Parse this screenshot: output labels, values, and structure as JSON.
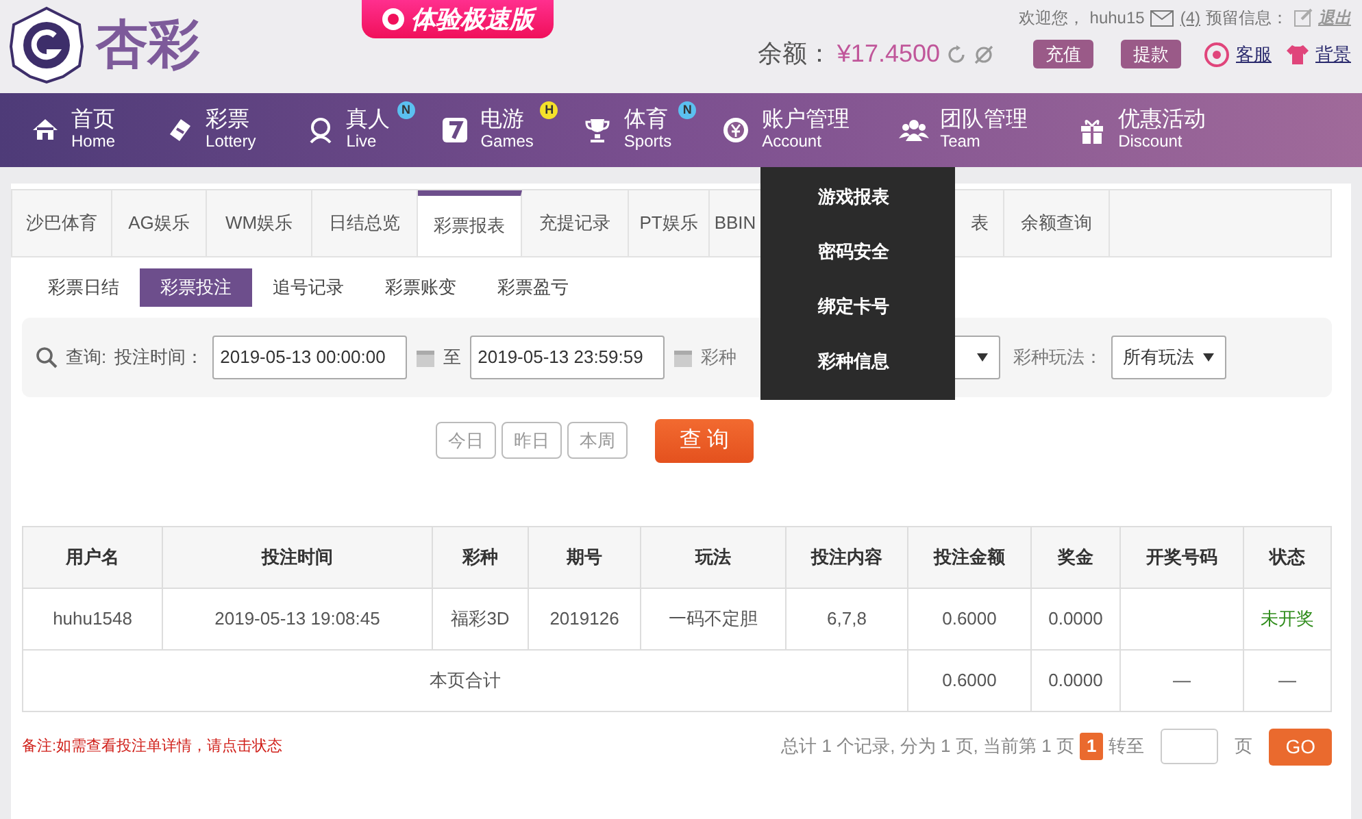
{
  "header": {
    "logo_text": "杏彩",
    "promo_button": "体验极速版",
    "user_bar": {
      "welcome": "欢迎您，",
      "username": "huhu15",
      "mail_count": "(4)",
      "reserve_label": "预留信息：",
      "logout": "退出"
    },
    "balance": {
      "label": "余额：",
      "amount": "¥17.4500",
      "buttons": [
        "充值",
        "提款"
      ],
      "service": "客服",
      "background": "背景"
    }
  },
  "nav": [
    {
      "label": "首页",
      "sub": "Home"
    },
    {
      "label": "彩票",
      "sub": "Lottery"
    },
    {
      "label": "真人",
      "sub": "Live",
      "badge": "N",
      "color": "#5bc0f0"
    },
    {
      "label": "电游",
      "sub": "Games",
      "badge": "H",
      "color": "#f5e12a"
    },
    {
      "label": "体育",
      "sub": "Sports",
      "badge": "N",
      "color": "#5bc0f0"
    },
    {
      "label": "账户管理",
      "sub": "Account"
    },
    {
      "label": "团队管理",
      "sub": "Team"
    },
    {
      "label": "优惠活动",
      "sub": "Discount"
    }
  ],
  "dropdown": [
    "游戏报表",
    "密码安全",
    "绑定卡号",
    "彩种信息"
  ],
  "tabs": [
    {
      "label": "沙巴体育",
      "selected": false
    },
    {
      "label": "AG娱乐",
      "selected": false
    },
    {
      "label": "WM娱乐",
      "selected": false
    },
    {
      "label": "日结总览",
      "selected": false
    },
    {
      "label": "彩票报表",
      "selected": true
    },
    {
      "label": "充提记录",
      "selected": false
    },
    {
      "label": "PT娱乐",
      "selected": false
    },
    {
      "label": "BBIN",
      "selected": false
    },
    {
      "label": "表",
      "selected": false
    },
    {
      "label": "余额查询",
      "selected": false
    }
  ],
  "subtabs": [
    {
      "label": "彩票日结",
      "selected": false
    },
    {
      "label": "彩票投注",
      "selected": true
    },
    {
      "label": "追号记录",
      "selected": false
    },
    {
      "label": "彩票账变",
      "selected": false
    },
    {
      "label": "彩票盈亏",
      "selected": false
    }
  ],
  "filter": {
    "query_label": "查询:",
    "time_label": "投注时间：",
    "start": "2019-05-13 00:00:00",
    "to": "至",
    "end": "2019-05-13 23:59:59",
    "lottery_label": "彩种",
    "play_label": "彩种玩法：",
    "play_value": "所有玩法"
  },
  "quick_buttons": [
    "今日",
    "昨日",
    "本周"
  ],
  "search_button": "查 询",
  "table": {
    "columns": [
      "用户名",
      "投注时间",
      "彩种",
      "期号",
      "玩法",
      "投注内容",
      "投注金额",
      "奖金",
      "开奖号码",
      "状态"
    ],
    "rows": [
      [
        "huhu1548",
        "2019-05-13 19:08:45",
        "福彩3D",
        "2019126",
        "一码不定胆",
        "6,7,8",
        "0.6000",
        "0.0000",
        "",
        "未开奖"
      ]
    ],
    "total": {
      "label": "本页合计",
      "cells": [
        "0.6000",
        "0.0000",
        "—",
        "—"
      ]
    }
  },
  "note": "备注:如需查看投注单详情，请点击状态",
  "pagination": {
    "summary": "总计 1 个记录, 分为 1 页, 当前第 1 页",
    "pages": [
      {
        "label": "1",
        "selected": true
      }
    ],
    "goto": "转至",
    "unit": "页",
    "go": "GO"
  }
}
